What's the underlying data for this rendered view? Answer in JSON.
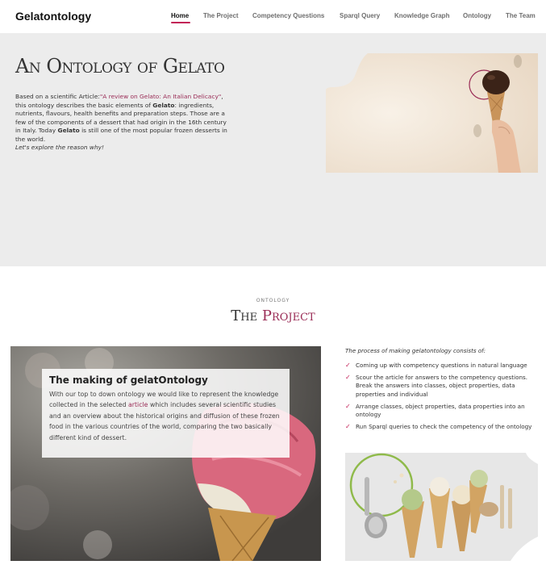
{
  "brand": "Gelatontology",
  "nav": {
    "items": [
      {
        "label": "Home",
        "active": true
      },
      {
        "label": "The Project"
      },
      {
        "label": "Competency Questions"
      },
      {
        "label": "Sparql Query"
      },
      {
        "label": "Knowledge Graph"
      },
      {
        "label": "Ontology"
      },
      {
        "label": "The Team"
      }
    ]
  },
  "hero": {
    "title": "An Ontology of Gelato",
    "text_prefix": "Based on a scientific Article:",
    "article_link": "\"A review on Gelato: An Italian Delicacy\"",
    "text_mid": ", this ontology describes the basic elements of ",
    "gelato1": "Gelato",
    "text_mid2": ": ingredients, nutrients, flavours, health benefits and preparation steps. Those are a few of the components of a dessert that had origin in the 16th century in Italy. Today ",
    "gelato2": "Gelato",
    "text_end": " is still one of the most popular frozen desserts in the world.",
    "tagline": "Let's explore the reason why!"
  },
  "project": {
    "subtitle": "ONTOLOGY",
    "title_the": "The",
    "title_project": "Project",
    "card": {
      "title": "The making of gelatOntology",
      "p_start": "With our top to down ontology we would like to represent the knowledge collected in the selected ",
      "p_link": "article",
      "p_end": " which includes several scientific studies and an overview about the historical origins and diffusion of these frozen food in the various countries of the world, comparing the two basically different kind of dessert."
    },
    "process_intro": "The process of making gelatontology consists of:",
    "steps": [
      "Coming up with competency questions in natural language",
      "Scour the article for answers to the competency questions. Break the answers into classes, object properties, data properties and individual",
      "Arrange classes, object properties, data properties into an ontology",
      "Run Sparql queries to check the competency of the ontology"
    ]
  },
  "colors": {
    "accent": "#9a2c56",
    "underline": "#c21e56",
    "hero_bg": "#ececec"
  },
  "icons": {
    "check": "check-icon"
  }
}
